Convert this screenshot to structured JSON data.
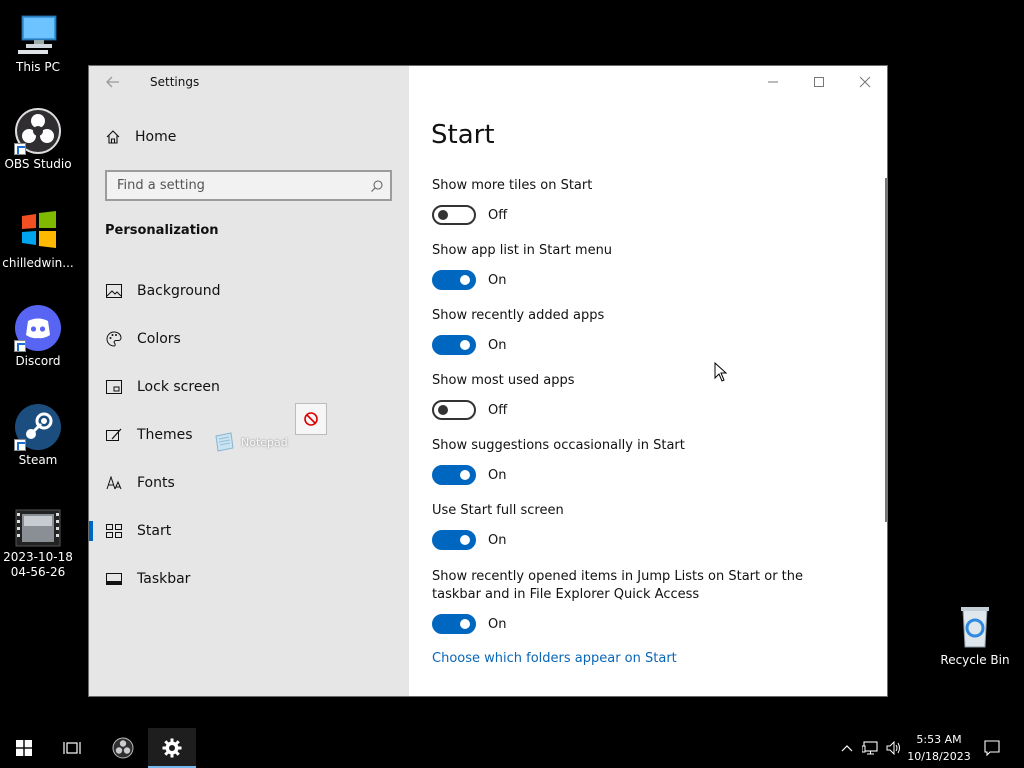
{
  "desktop": {
    "icons": [
      {
        "label": "This PC",
        "icon": "computer-icon"
      },
      {
        "label": "OBS Studio",
        "icon": "obs-icon"
      },
      {
        "label": "chilledwin...",
        "icon": "windows-flag-icon"
      },
      {
        "label": "Discord",
        "icon": "discord-icon"
      },
      {
        "label": "Steam",
        "icon": "steam-icon"
      },
      {
        "label": "2023-10-18\n04-56-26",
        "icon": "video-file-icon"
      },
      {
        "label": "Recycle Bin",
        "icon": "recycle-bin-icon"
      }
    ],
    "drag_ghost_label": "Notepad"
  },
  "window": {
    "title": "Settings",
    "sidebar": {
      "home_label": "Home",
      "search_placeholder": "Find a setting",
      "section_title": "Personalization",
      "items": [
        {
          "label": "Background",
          "icon": "picture-icon",
          "active": false
        },
        {
          "label": "Colors",
          "icon": "palette-icon",
          "active": false
        },
        {
          "label": "Lock screen",
          "icon": "lock-screen-icon",
          "active": false
        },
        {
          "label": "Themes",
          "icon": "themes-icon",
          "active": false
        },
        {
          "label": "Fonts",
          "icon": "fonts-icon",
          "active": false
        },
        {
          "label": "Start",
          "icon": "start-icon",
          "active": true
        },
        {
          "label": "Taskbar",
          "icon": "taskbar-icon",
          "active": false
        }
      ]
    },
    "page_title": "Start",
    "settings": [
      {
        "label": "Show more tiles on Start",
        "on": false,
        "state": "Off"
      },
      {
        "label": "Show app list in Start menu",
        "on": true,
        "state": "On"
      },
      {
        "label": "Show recently added apps",
        "on": true,
        "state": "On"
      },
      {
        "label": "Show most used apps",
        "on": false,
        "state": "Off"
      },
      {
        "label": "Show suggestions occasionally in Start",
        "on": true,
        "state": "On"
      },
      {
        "label": "Use Start full screen",
        "on": true,
        "state": "On"
      },
      {
        "label": "Show recently opened items in Jump Lists on Start or the taskbar and in File Explorer Quick Access",
        "on": true,
        "state": "On"
      }
    ],
    "link": "Choose which folders appear on Start"
  },
  "taskbar": {
    "clock_time": "5:53 AM",
    "clock_date": "10/18/2023"
  },
  "colors": {
    "accent": "#0067c0",
    "sidebar_bg": "#e6e6e6",
    "link": "#0a66b7"
  }
}
